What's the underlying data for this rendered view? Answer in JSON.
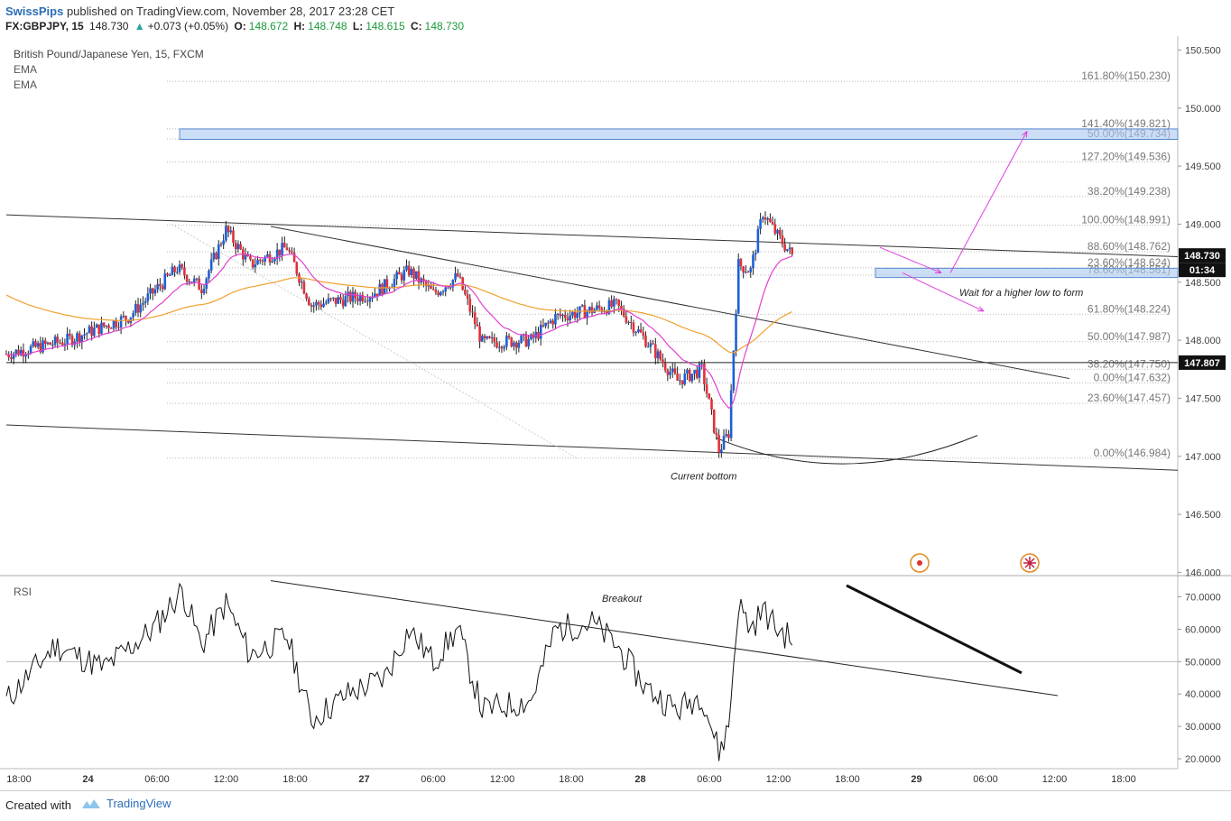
{
  "header": {
    "publisher": "SwissPips",
    "published_text": "published on TradingView.com, November 28, 2017 23:28 CET",
    "symbol": "FX:GBPJPY, 15",
    "last": "148.730",
    "change": "+0.073 (+0.05%)",
    "open_label": "O:",
    "open": "148.672",
    "high_label": "H:",
    "high": "148.748",
    "low_label": "L:",
    "low": "148.615",
    "close_label": "C:",
    "close": "148.730"
  },
  "legend": {
    "instrument": "British Pound/Japanese Yen, 15, FXCM",
    "ema1": "EMA",
    "ema2": "EMA",
    "rsi": "RSI"
  },
  "colors": {
    "up": "#1e5fd6",
    "down": "#e0303a",
    "ema_fast": "#e040d0",
    "ema_slow": "#f0a030",
    "fib_text": "#777777",
    "zone": "#aac8ee",
    "arrow": "#e040e0"
  },
  "chart_data": [
    {
      "type": "candlestick",
      "title": "British Pound/Japanese Yen, 15, FXCM",
      "ylim": [
        145.98,
        150.62
      ],
      "y_ticks": [
        "150.500",
        "150.000",
        "149.500",
        "149.000",
        "148.500",
        "148.000",
        "147.500",
        "147.000",
        "146.500",
        "146.000"
      ],
      "x_ticks": [
        "18:00",
        "24",
        "06:00",
        "12:00",
        "18:00",
        "27",
        "06:00",
        "12:00",
        "18:00",
        "28",
        "06:00",
        "12:00",
        "18:00",
        "29",
        "06:00",
        "12:00",
        "18:00"
      ],
      "price_label": "148.730",
      "countdown": "01:34",
      "hline_label": "147.807",
      "hline": 147.807,
      "key_points": [
        {
          "t": 0,
          "p": 147.88
        },
        {
          "t": 25,
          "p": 148.0
        },
        {
          "t": 50,
          "p": 148.2
        },
        {
          "t": 70,
          "p": 148.62
        },
        {
          "t": 80,
          "p": 148.45
        },
        {
          "t": 90,
          "p": 148.95
        },
        {
          "t": 100,
          "p": 148.65
        },
        {
          "t": 115,
          "p": 148.8
        },
        {
          "t": 125,
          "p": 148.3
        },
        {
          "t": 150,
          "p": 148.4
        },
        {
          "t": 165,
          "p": 148.6
        },
        {
          "t": 175,
          "p": 148.4
        },
        {
          "t": 185,
          "p": 148.55
        },
        {
          "t": 195,
          "p": 147.98
        },
        {
          "t": 215,
          "p": 148.0
        },
        {
          "t": 225,
          "p": 148.2
        },
        {
          "t": 250,
          "p": 148.3
        },
        {
          "t": 262,
          "p": 148.0
        },
        {
          "t": 275,
          "p": 147.65
        },
        {
          "t": 285,
          "p": 147.75
        },
        {
          "t": 292,
          "p": 147.05
        },
        {
          "t": 296,
          "p": 147.2
        },
        {
          "t": 300,
          "p": 148.65
        },
        {
          "t": 305,
          "p": 148.6
        },
        {
          "t": 310,
          "p": 149.1
        },
        {
          "t": 316,
          "p": 148.9
        },
        {
          "t": 322,
          "p": 148.73
        }
      ],
      "fib_levels": [
        {
          "label": "161.80%(150.230)",
          "price": 150.23
        },
        {
          "label": "141.40%(149.821)",
          "price": 149.821
        },
        {
          "label": "50.00%(149.734)",
          "price": 149.734
        },
        {
          "label": "127.20%(149.536)",
          "price": 149.536
        },
        {
          "label": "38.20%(149.238)",
          "price": 149.238
        },
        {
          "label": "100.00%(148.991)",
          "price": 148.991
        },
        {
          "label": "88.60%(148.762)",
          "price": 148.762
        },
        {
          "label": "23.60%(148.624)",
          "price": 148.624
        },
        {
          "label": "78.60%(148.561)",
          "price": 148.561
        },
        {
          "label": "61.80%(148.224)",
          "price": 148.224
        },
        {
          "label": "50.00%(147.987)",
          "price": 147.987
        },
        {
          "label": "38.20%(147.750)",
          "price": 147.75
        },
        {
          "label": "0.00%(147.632)",
          "price": 147.632
        },
        {
          "label": "23.60%(147.457)",
          "price": 147.457
        },
        {
          "label": "0.00%(146.984)",
          "price": 146.984
        }
      ],
      "annotations": [
        "Wait for a higher low to form",
        "Current bottom"
      ]
    },
    {
      "type": "line",
      "title": "RSI",
      "ylim": [
        17.5,
        76
      ],
      "y_ticks": [
        "70.0000",
        "60.0000",
        "50.0000",
        "40.0000",
        "30.0000",
        "20.0000"
      ],
      "key_points": [
        {
          "t": 0,
          "p": 38
        },
        {
          "t": 20,
          "p": 55
        },
        {
          "t": 40,
          "p": 48
        },
        {
          "t": 60,
          "p": 60
        },
        {
          "t": 72,
          "p": 72
        },
        {
          "t": 80,
          "p": 55
        },
        {
          "t": 90,
          "p": 68
        },
        {
          "t": 100,
          "p": 52
        },
        {
          "t": 115,
          "p": 58
        },
        {
          "t": 125,
          "p": 32
        },
        {
          "t": 140,
          "p": 40
        },
        {
          "t": 155,
          "p": 45
        },
        {
          "t": 165,
          "p": 60
        },
        {
          "t": 175,
          "p": 50
        },
        {
          "t": 185,
          "p": 60
        },
        {
          "t": 195,
          "p": 35
        },
        {
          "t": 215,
          "p": 38
        },
        {
          "t": 225,
          "p": 60
        },
        {
          "t": 240,
          "p": 62
        },
        {
          "t": 250,
          "p": 55
        },
        {
          "t": 262,
          "p": 42
        },
        {
          "t": 275,
          "p": 35
        },
        {
          "t": 285,
          "p": 40
        },
        {
          "t": 292,
          "p": 22
        },
        {
          "t": 296,
          "p": 30
        },
        {
          "t": 300,
          "p": 68
        },
        {
          "t": 305,
          "p": 60
        },
        {
          "t": 310,
          "p": 66
        },
        {
          "t": 316,
          "p": 60
        },
        {
          "t": 322,
          "p": 57
        }
      ],
      "annotations": [
        "Breakout"
      ],
      "midline": 50
    }
  ],
  "footer": {
    "created": "Created with",
    "brand": "TradingView"
  }
}
